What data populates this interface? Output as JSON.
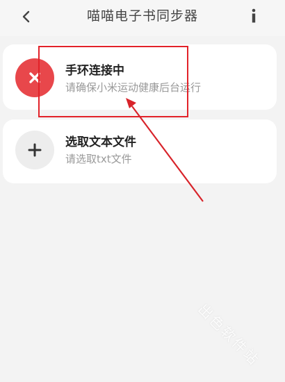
{
  "header": {
    "title": "喵喵电子书同步器",
    "back_icon": "chevron-left-icon",
    "info_icon": "info-icon"
  },
  "cards": [
    {
      "title": "手环连接中",
      "subtitle": "请确保小米运动健康后台运行",
      "icon": "close-icon",
      "icon_bg": "#e8474b"
    },
    {
      "title": "选取文本文件",
      "subtitle": "请选取txt文件",
      "icon": "plus-icon",
      "icon_bg": "#ededed"
    }
  ],
  "watermark": "出色软件站",
  "colors": {
    "background": "#f3f3f3",
    "card": "#ffffff",
    "highlight": "#e22229"
  }
}
